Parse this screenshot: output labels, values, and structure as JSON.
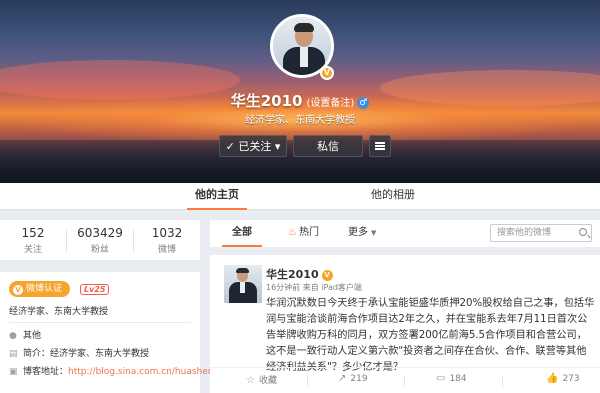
{
  "profile": {
    "name": "华生2010",
    "remark": "(设置备注)",
    "gender_icon": "♂",
    "verified_icon": "V",
    "intro": "经济学家、东南大学教授"
  },
  "buttons": {
    "follow": "✓ 已关注 ▾",
    "message": "私信"
  },
  "tabs": {
    "home": "他的主页",
    "album": "他的相册"
  },
  "stats": [
    {
      "num": "152",
      "label": "关注"
    },
    {
      "num": "603429",
      "label": "粉丝"
    },
    {
      "num": "1032",
      "label": "微博"
    }
  ],
  "info": {
    "cert_label": "微博认证",
    "level": "Lv25",
    "cert_desc": "经济学家、东南大学教授",
    "location": "其他",
    "bio": "简介：经济学家、东南大学教授",
    "blog_label": "博客地址：",
    "blog_url": "http://blog.sina.com.cn/huasheng"
  },
  "filter": {
    "all": "全部",
    "hot": "热门",
    "more": "更多",
    "search_placeholder": "搜索他的微博"
  },
  "post": {
    "author": "华生2010",
    "verified_icon": "V",
    "meta": "16分钟前 来自 iPad客户端",
    "text": "华润沉默数日今天终于承认宝能钜盛华质押20%股权给自己之事，包括华润与宝能洽谈前海合作项目达2年之久，并在宝能系去年7月11日首次公告举牌收购万科的同月，双方签署200亿前海5.5合作项目和合营公司，这不是一致行动人定义第六款\"投资者之间存在合伙、合作、联营等其他经济利益关系\"？多少亿才是？",
    "actions": {
      "favorite": "收藏",
      "repost": "219",
      "comment": "184",
      "like": "273"
    }
  },
  "icons": {
    "location": "location-pin-icon",
    "bio": "document-icon",
    "blog": "link-icon"
  }
}
